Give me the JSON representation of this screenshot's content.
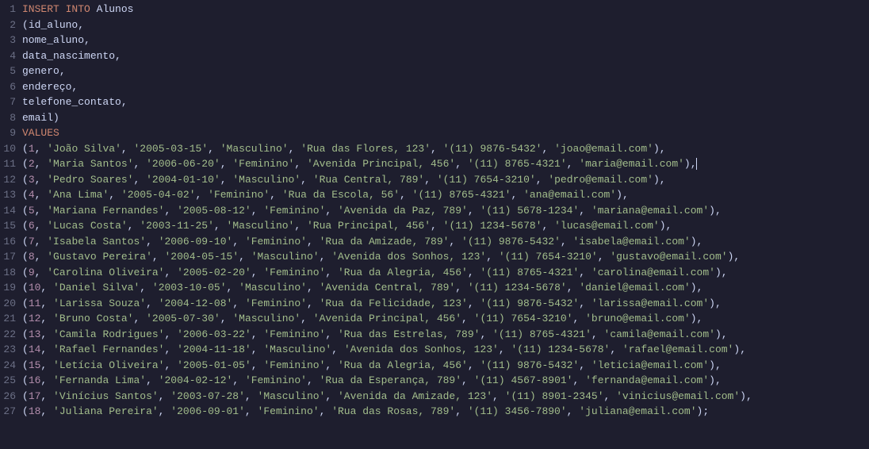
{
  "sql": {
    "insert_kw": "INSERT INTO",
    "table": "Alunos",
    "columns": [
      "id_aluno",
      "nome_aluno",
      "data_nascimento",
      "genero",
      "endereço",
      "telefone_contato",
      "email"
    ],
    "values_kw": "VALUES",
    "rows": [
      {
        "id": 1,
        "nome": "João Silva",
        "data": "2005-03-15",
        "genero": "Masculino",
        "endereco": "Rua das Flores, 123",
        "tel": "(11) 9876-5432",
        "email": "joao@email.com",
        "term": ","
      },
      {
        "id": 2,
        "nome": "Maria Santos",
        "data": "2006-06-20",
        "genero": "Feminino",
        "endereco": "Avenida Principal, 456",
        "tel": "(11) 8765-4321",
        "email": "maria@email.com",
        "term": ",",
        "cursor": true
      },
      {
        "id": 3,
        "nome": "Pedro Soares",
        "data": "2004-01-10",
        "genero": "Masculino",
        "endereco": "Rua Central, 789",
        "tel": "(11) 7654-3210",
        "email": "pedro@email.com",
        "term": ","
      },
      {
        "id": 4,
        "nome": "Ana Lima",
        "data": "2005-04-02",
        "genero": "Feminino",
        "endereco": "Rua da Escola, 56",
        "tel": "(11) 8765-4321",
        "email": "ana@email.com",
        "term": ","
      },
      {
        "id": 5,
        "nome": "Mariana Fernandes",
        "data": "2005-08-12",
        "genero": "Feminino",
        "endereco": "Avenida da Paz, 789",
        "tel": "(11) 5678-1234",
        "email": "mariana@email.com",
        "term": ","
      },
      {
        "id": 6,
        "nome": "Lucas Costa",
        "data": "2003-11-25",
        "genero": "Masculino",
        "endereco": "Rua Principal, 456",
        "tel": "(11) 1234-5678",
        "email": "lucas@email.com",
        "term": ","
      },
      {
        "id": 7,
        "nome": "Isabela Santos",
        "data": "2006-09-10",
        "genero": "Feminino",
        "endereco": "Rua da Amizade, 789",
        "tel": "(11) 9876-5432",
        "email": "isabela@email.com",
        "term": ","
      },
      {
        "id": 8,
        "nome": "Gustavo Pereira",
        "data": "2004-05-15",
        "genero": "Masculino",
        "endereco": "Avenida dos Sonhos, 123",
        "tel": "(11) 7654-3210",
        "email": "gustavo@email.com",
        "term": ","
      },
      {
        "id": 9,
        "nome": "Carolina Oliveira",
        "data": "2005-02-20",
        "genero": "Feminino",
        "endereco": "Rua da Alegria, 456",
        "tel": "(11) 8765-4321",
        "email": "carolina@email.com",
        "term": ","
      },
      {
        "id": 10,
        "nome": "Daniel Silva",
        "data": "2003-10-05",
        "genero": "Masculino",
        "endereco": "Avenida Central, 789",
        "tel": "(11) 1234-5678",
        "email": "daniel@email.com",
        "term": ","
      },
      {
        "id": 11,
        "nome": "Larissa Souza",
        "data": "2004-12-08",
        "genero": "Feminino",
        "endereco": "Rua da Felicidade, 123",
        "tel": "(11) 9876-5432",
        "email": "larissa@email.com",
        "term": ","
      },
      {
        "id": 12,
        "nome": "Bruno Costa",
        "data": "2005-07-30",
        "genero": "Masculino",
        "endereco": "Avenida Principal, 456",
        "tel": "(11) 7654-3210",
        "email": "bruno@email.com",
        "term": ","
      },
      {
        "id": 13,
        "nome": "Camila Rodrigues",
        "data": "2006-03-22",
        "genero": "Feminino",
        "endereco": "Rua das Estrelas, 789",
        "tel": "(11) 8765-4321",
        "email": "camila@email.com",
        "term": ","
      },
      {
        "id": 14,
        "nome": "Rafael Fernandes",
        "data": "2004-11-18",
        "genero": "Masculino",
        "endereco": "Avenida dos Sonhos, 123",
        "tel": "(11) 1234-5678",
        "email": "rafael@email.com",
        "term": ","
      },
      {
        "id": 15,
        "nome": "Letícia Oliveira",
        "data": "2005-01-05",
        "genero": "Feminino",
        "endereco": "Rua da Alegria, 456",
        "tel": "(11) 9876-5432",
        "email": "leticia@email.com",
        "term": ","
      },
      {
        "id": 16,
        "nome": "Fernanda Lima",
        "data": "2004-02-12",
        "genero": "Feminino",
        "endereco": "Rua da Esperança, 789",
        "tel": "(11) 4567-8901",
        "email": "fernanda@email.com",
        "term": ","
      },
      {
        "id": 17,
        "nome": "Vinícius Santos",
        "data": "2003-07-28",
        "genero": "Masculino",
        "endereco": "Avenida da Amizade, 123",
        "tel": "(11) 8901-2345",
        "email": "vinicius@email.com",
        "term": ","
      },
      {
        "id": 18,
        "nome": "Juliana Pereira",
        "data": "2006-09-01",
        "genero": "Feminino",
        "endereco": "Rua das Rosas, 789",
        "tel": "(11) 3456-7890",
        "email": "juliana@email.com",
        "term": ";"
      }
    ]
  }
}
